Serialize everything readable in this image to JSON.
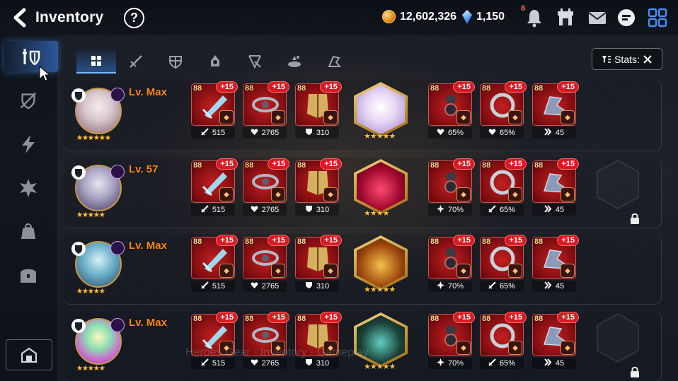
{
  "header": {
    "title": "Inventory",
    "help_label": "?",
    "gold": "12,602,326",
    "crystals": "1,150",
    "notification_count": "8",
    "icons": [
      "gold-coin-icon",
      "crystal-icon",
      "bell-icon",
      "shop-icon",
      "mail-icon",
      "chat-icon",
      "grid-menu-icon"
    ]
  },
  "sidebar": {
    "items": [
      "equipment-icon",
      "artifact-icon",
      "exclusive-equipment-icon",
      "catalyst-icon",
      "material-icon",
      "chest-icon"
    ],
    "bottom": "storage-icon"
  },
  "tabs": [
    "all-icon",
    "weapon-icon",
    "armor-icon",
    "helmet-icon",
    "necklace-icon",
    "ring-icon",
    "boots-icon"
  ],
  "stats_button": {
    "label": "Stats:"
  },
  "heroes": [
    {
      "level": "Lv. Max",
      "stars": "★★★★★★",
      "artifact_stars": "★★★★★",
      "items": [
        {
          "lv": "88",
          "enh": "+15",
          "stat_icon": "attack",
          "stat": "515"
        },
        {
          "lv": "88",
          "enh": "+15",
          "stat_icon": "health",
          "stat": "2765"
        },
        {
          "lv": "88",
          "enh": "+15",
          "stat_icon": "defense",
          "stat": "310"
        },
        {
          "lv": "88",
          "enh": "+15",
          "stat_icon": "health",
          "stat": "65%"
        },
        {
          "lv": "88",
          "enh": "+15",
          "stat_icon": "health",
          "stat": "65%"
        },
        {
          "lv": "88",
          "enh": "+15",
          "stat_icon": "speed",
          "stat": "45"
        }
      ],
      "locked": false
    },
    {
      "level": "Lv. 57",
      "stars": "★★★★★",
      "artifact_stars": "★★★★",
      "items": [
        {
          "lv": "88",
          "enh": "+15",
          "stat_icon": "attack",
          "stat": "515"
        },
        {
          "lv": "88",
          "enh": "+15",
          "stat_icon": "health",
          "stat": "2765"
        },
        {
          "lv": "88",
          "enh": "+15",
          "stat_icon": "defense",
          "stat": "310"
        },
        {
          "lv": "88",
          "enh": "+15",
          "stat_icon": "crit",
          "stat": "70%"
        },
        {
          "lv": "88",
          "enh": "+15",
          "stat_icon": "attack",
          "stat": "65%"
        },
        {
          "lv": "88",
          "enh": "+15",
          "stat_icon": "speed",
          "stat": "45"
        }
      ],
      "locked": true
    },
    {
      "level": "Lv. Max",
      "stars": "★★★★★",
      "artifact_stars": "★★★★★",
      "items": [
        {
          "lv": "88",
          "enh": "+15",
          "stat_icon": "attack",
          "stat": "515"
        },
        {
          "lv": "88",
          "enh": "+15",
          "stat_icon": "health",
          "stat": "2765"
        },
        {
          "lv": "88",
          "enh": "+15",
          "stat_icon": "defense",
          "stat": "310"
        },
        {
          "lv": "88",
          "enh": "+15",
          "stat_icon": "crit",
          "stat": "70%"
        },
        {
          "lv": "88",
          "enh": "+15",
          "stat_icon": "attack",
          "stat": "65%"
        },
        {
          "lv": "88",
          "enh": "+15",
          "stat_icon": "speed",
          "stat": "45"
        }
      ],
      "locked": false
    },
    {
      "level": "Lv. Max",
      "stars": "★★★★★",
      "artifact_stars": "★★★★★",
      "items": [
        {
          "lv": "88",
          "enh": "+15",
          "stat_icon": "attack",
          "stat": "515"
        },
        {
          "lv": "88",
          "enh": "+15",
          "stat_icon": "health",
          "stat": "2765"
        },
        {
          "lv": "88",
          "enh": "+15",
          "stat_icon": "defense",
          "stat": "310"
        },
        {
          "lv": "88",
          "enh": "+15",
          "stat_icon": "crit",
          "stat": "70%"
        },
        {
          "lv": "88",
          "enh": "+15",
          "stat_icon": "attack",
          "stat": "65%"
        },
        {
          "lv": "88",
          "enh": "+15",
          "stat_icon": "speed",
          "stat": "45"
        }
      ],
      "locked": true
    }
  ],
  "colors": {
    "level": "#ff8a1a",
    "enhance_badge": "#d81a22",
    "accent": "#7ab8ff"
  }
}
